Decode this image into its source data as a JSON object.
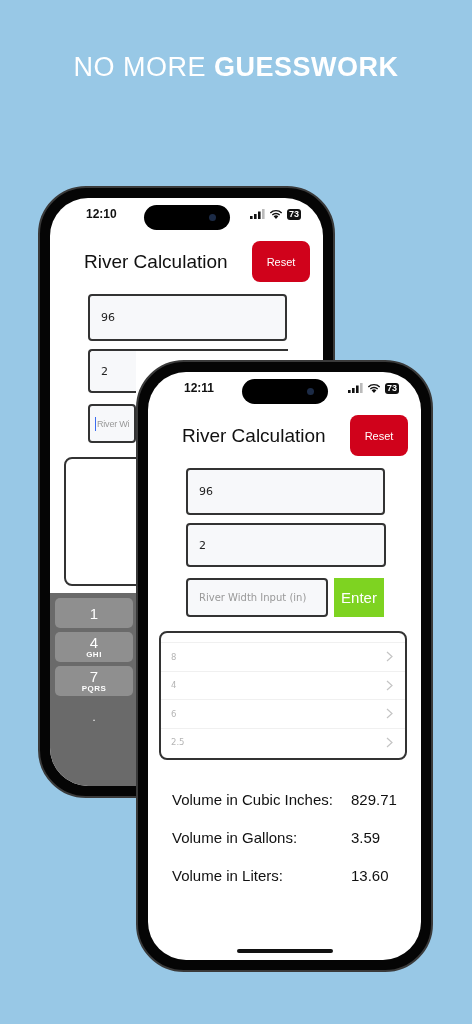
{
  "headline": "NO MORE **GUESSWORK**",
  "back_phone": {
    "status": {
      "time": "12:10",
      "battery": "73"
    },
    "title": "River Calculation",
    "reset": "Reset",
    "fields": [
      {
        "value": "96"
      },
      {
        "value": "2"
      },
      {
        "placeholder": "River Wi",
        "focused": true
      }
    ],
    "keypad": [
      {
        "kind": "key",
        "digit": "1"
      },
      {
        "kind": "key",
        "digit": "4",
        "letters": "GHI"
      },
      {
        "kind": "key",
        "digit": "7",
        "letters": "PQRS"
      },
      {
        "kind": "plain",
        "digit": "."
      }
    ]
  },
  "front_phone": {
    "status": {
      "time": "12:11",
      "battery": "73"
    },
    "title": "River Calculation",
    "reset": "Reset",
    "fields": [
      {
        "value": "96"
      },
      {
        "value": "2"
      },
      {
        "placeholder": "River Width Input (in)",
        "focused": false
      }
    ],
    "enter": "Enter",
    "list": [
      "8",
      "4",
      "6",
      "2.5"
    ],
    "results": [
      {
        "label": "Volume in Cubic Inches:",
        "value": "829.71"
      },
      {
        "label": "Volume in Gallons:",
        "value": "3.59"
      },
      {
        "label": "Volume in Liters:",
        "value": "13.60"
      }
    ]
  }
}
